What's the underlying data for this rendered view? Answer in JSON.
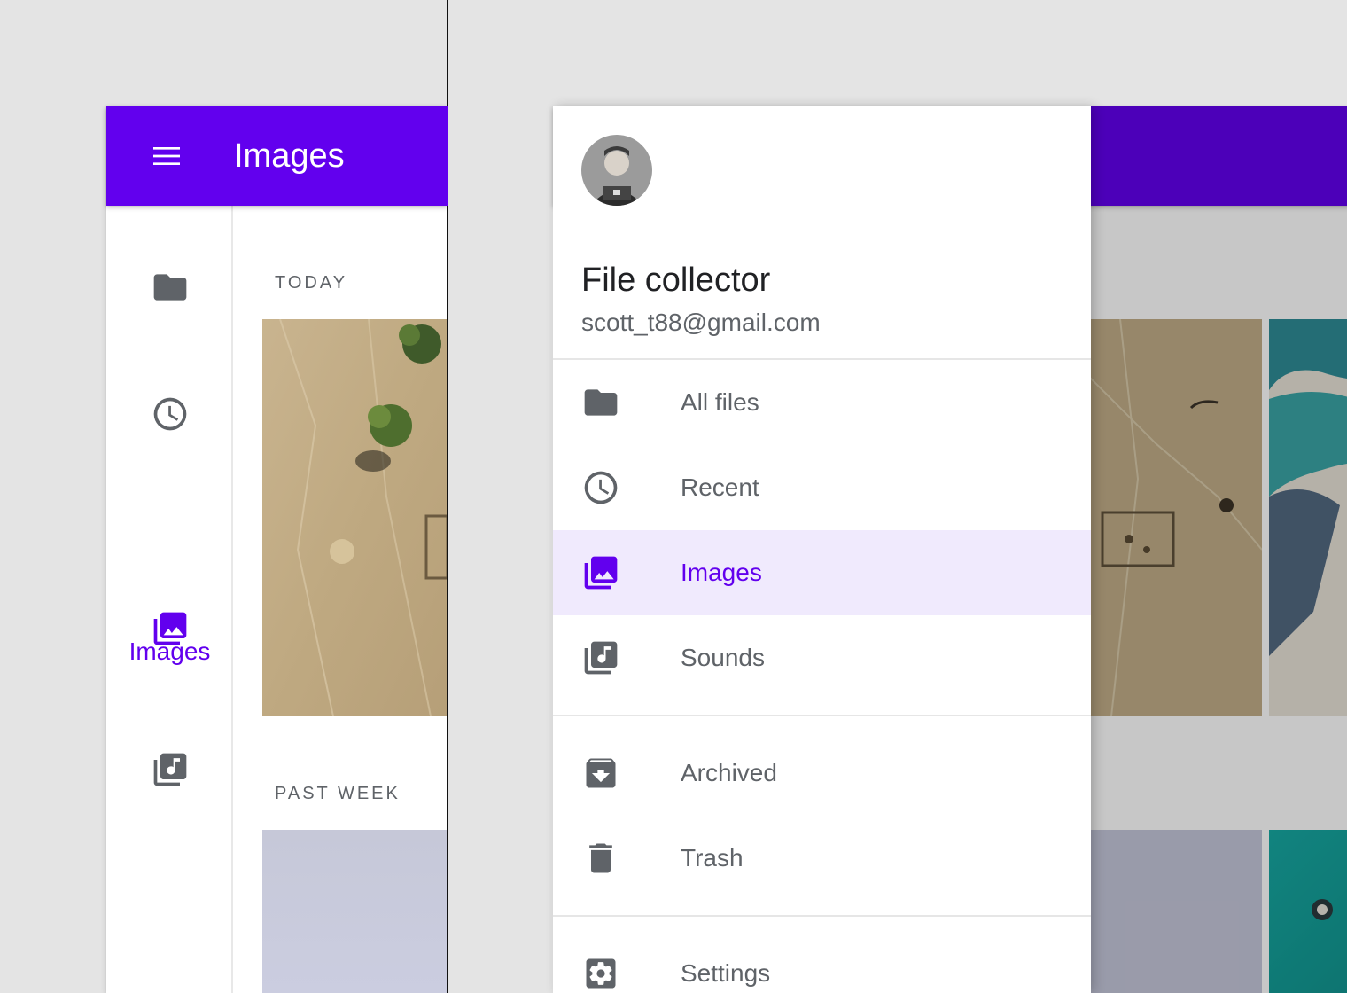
{
  "colors": {
    "primary": "#6200ee",
    "icon_gray": "#5f6368",
    "active_bg": "#f0eafd",
    "background": "#e4e4e4"
  },
  "left": {
    "topbar": {
      "title": "Images",
      "menu_icon": "menu-icon"
    },
    "rail": [
      {
        "icon": "folder-icon",
        "label": "",
        "active": false
      },
      {
        "icon": "clock-icon",
        "label": "",
        "active": false
      },
      {
        "icon": "images-icon",
        "label": "Images",
        "active": true
      },
      {
        "icon": "music-library-icon",
        "label": "",
        "active": false
      }
    ],
    "sections": [
      {
        "label": "TODAY"
      },
      {
        "label": "PAST WEEK"
      }
    ]
  },
  "right": {
    "drawer": {
      "title": "File collector",
      "subtitle": "scott_t88@gmail.com",
      "primary_items": [
        {
          "icon": "folder-icon",
          "label": "All files",
          "active": false
        },
        {
          "icon": "clock-icon",
          "label": "Recent",
          "active": false
        },
        {
          "icon": "images-icon",
          "label": "Images",
          "active": true
        },
        {
          "icon": "music-library-icon",
          "label": "Sounds",
          "active": false
        }
      ],
      "secondary_items": [
        {
          "icon": "archive-icon",
          "label": "Archived"
        },
        {
          "icon": "trash-icon",
          "label": "Trash"
        }
      ],
      "tertiary_items": [
        {
          "icon": "settings-icon",
          "label": "Settings"
        }
      ]
    }
  }
}
